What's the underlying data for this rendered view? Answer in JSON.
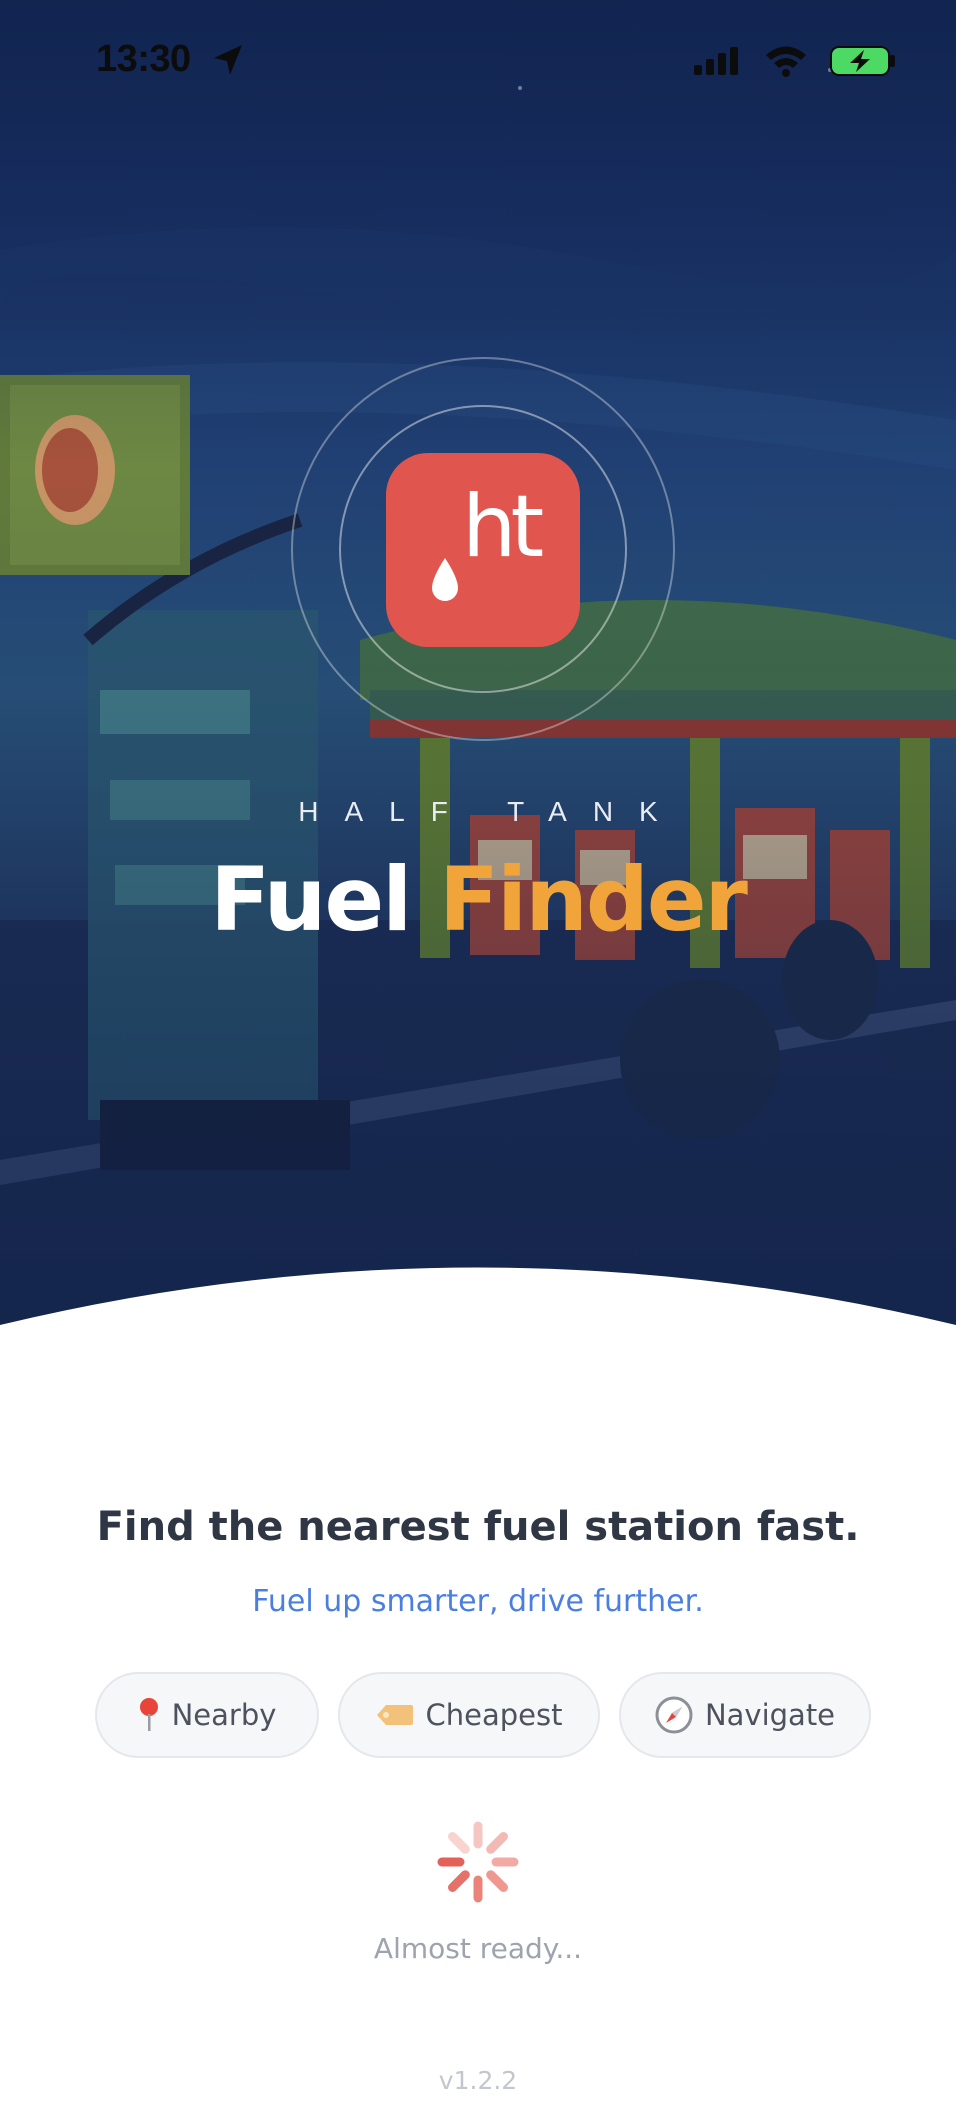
{
  "status_bar": {
    "time": "13:30",
    "location_icon": "location-arrow-icon",
    "signal_icon": "cellular-signal-icon",
    "wifi_icon": "wifi-icon",
    "battery_icon": "battery-charging-icon"
  },
  "hero": {
    "brand_subtitle": "HALF TANK",
    "title_word_1": "Fuel",
    "title_word_2": "Finder",
    "logo_text": "ht",
    "logo_color": "#e0554d",
    "accent_color": "#f0a43a"
  },
  "content": {
    "headline": "Find the nearest fuel station fast.",
    "tagline": "Fuel up smarter, drive further.",
    "tagline_color": "#4a7fe0",
    "chips": [
      {
        "label": "Nearby",
        "icon": "pin-icon"
      },
      {
        "label": "Cheapest",
        "icon": "price-tag-icon"
      },
      {
        "label": "Navigate",
        "icon": "compass-icon"
      }
    ]
  },
  "loading": {
    "text": "Almost ready...",
    "icon": "spinner-icon"
  },
  "version": "v1.2.2"
}
